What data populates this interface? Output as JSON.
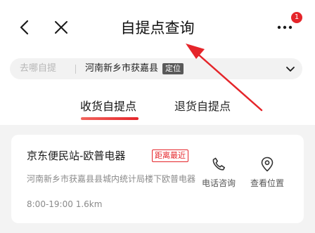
{
  "header": {
    "title": "自提点查询",
    "notification_count": "1",
    "icons": {
      "back": "chevron-left-icon",
      "close": "close-icon",
      "more": "more-dots-icon"
    }
  },
  "location_bar": {
    "placeholder": "去哪自提",
    "address": "河南新乡市获嘉县",
    "locate_label": "定位"
  },
  "tabs": [
    {
      "label": "收货自提点",
      "active": true
    },
    {
      "label": "退货自提点",
      "active": false
    }
  ],
  "stations": [
    {
      "name": "京东便民站-欧普电器",
      "tag": "距离最近",
      "address": "河南新乡市获嘉县县城内统计局楼下欧普电器",
      "hours": "8:00-19:00",
      "distance": "1.6km",
      "actions": {
        "call": "电话咨询",
        "map": "查看位置"
      }
    }
  ],
  "colors": {
    "accent": "#e5252a",
    "muted_text": "#8a8a8a",
    "list_background": "#f3f3f3",
    "annotation_arrow": "#e5252a"
  }
}
